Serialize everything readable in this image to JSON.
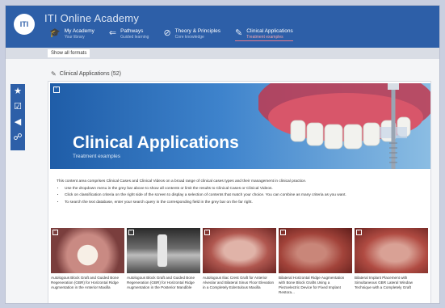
{
  "app": {
    "title": "ITI Online Academy",
    "logo_text": "ITI"
  },
  "nav": [
    {
      "label": "My Academy",
      "sub": "Your library",
      "icon": "graduation-cap-icon",
      "glyph": "🎓"
    },
    {
      "label": "Pathways",
      "sub": "Guided learning",
      "icon": "pathway-arrows-icon",
      "glyph": "⇐"
    },
    {
      "label": "Theory & Principles",
      "sub": "Core knowledge",
      "icon": "clipboard-icon",
      "glyph": "⊘"
    },
    {
      "label": "Clinical Applications",
      "sub": "Treatment examples",
      "icon": "instrument-icon",
      "glyph": "✎",
      "active": true
    }
  ],
  "filter": {
    "show_all_label": "Show all formats"
  },
  "sidebar": [
    {
      "icon": "star-icon",
      "glyph": "★"
    },
    {
      "icon": "checklist-icon",
      "glyph": "☑"
    },
    {
      "icon": "megaphone-icon",
      "glyph": "◀"
    },
    {
      "icon": "network-icon",
      "glyph": "☍"
    }
  ],
  "breadcrumb": {
    "label": "Clinical Applications (52)"
  },
  "banner": {
    "title": "Clinical Applications",
    "subtitle": "Treatment examples",
    "bg_color": "#2d5fa8"
  },
  "description": {
    "intro": "This content area comprises Clinical Cases and Clinical Videos on a broad range of clinical cases types and their management in clinical practice.",
    "bullets": [
      "Use the dropdown menu in the grey bar above to show all contents or limit the results to Clinical Cases or Clinical Videos.",
      "Click on classification criteria on the right side of the screen to display a selection of contents that match your choice. You can combine as many criteria as you want.",
      "To search the text database, enter your search query in the corresponding field in the grey bar on the far right."
    ]
  },
  "thumbnails": [
    {
      "caption": "Autologous Block Graft and Guided Bone Regeneration (GBR) for Horizontal Ridge Augmentation in the Anterior Maxilla"
    },
    {
      "caption": "Autologous Block Graft and Guided Bone Regeneration (GBR) for Horizontal Ridge Augmentation in the Posterior Mandible"
    },
    {
      "caption": "Autologous Iliac Crest Graft for Anterior Alveolar and Bilateral Sinus Floor Elevation in a Completely Edentulous Maxilla"
    },
    {
      "caption": "Bilateral Horizontal Ridge Augmentation with Bone Block Grafts Using a Piezoelectric Device for Fixed Implant Restora..."
    },
    {
      "caption": "Bilateral Implant Placement with Simultaneous GBR Lateral Window Technique with a Completely Graft"
    }
  ]
}
